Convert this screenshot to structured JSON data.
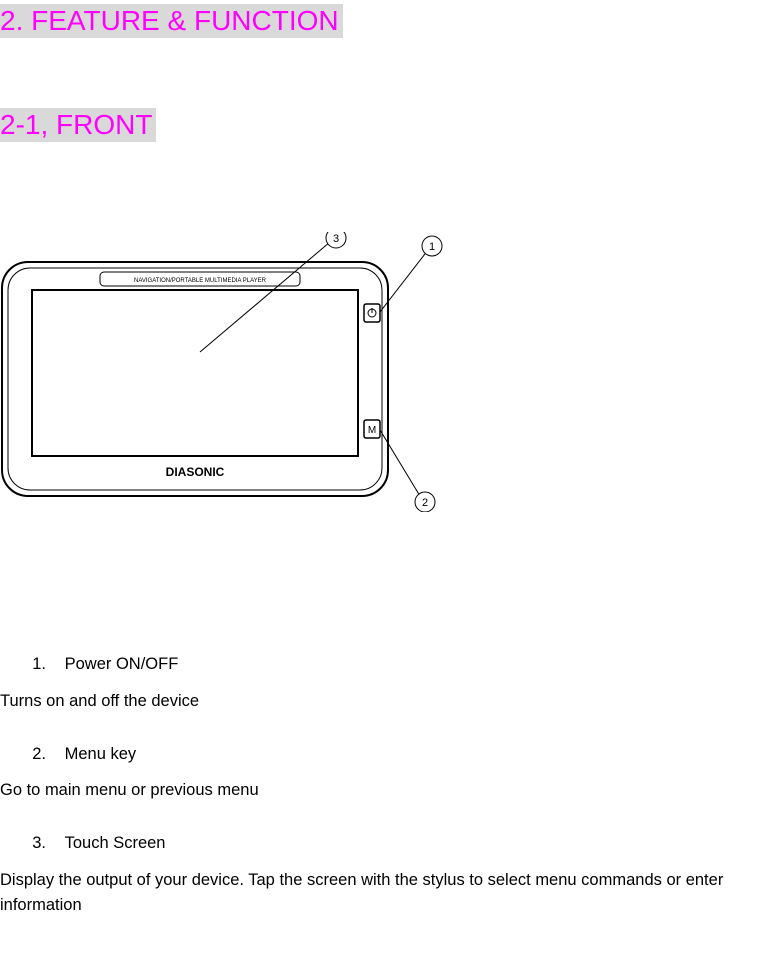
{
  "section": {
    "title": "2. FEATURE & FUNCTION",
    "subtitle": "2-1, FRONT"
  },
  "device": {
    "header_text": "NAVIGATION/PORTABLE MULTIMEDIA PLAYER",
    "brand": "DIASONIC",
    "power_icon_label": "power",
    "menu_button_label": "M"
  },
  "callouts": {
    "one": "1",
    "two": "2",
    "three": "3"
  },
  "items": [
    {
      "num": "1.",
      "label": "Power ON/OFF",
      "desc": "Turns on and off the device"
    },
    {
      "num": "2.",
      "label": "Menu key",
      "desc": "Go to main menu or previous menu"
    },
    {
      "num": "3.",
      "label": "Touch Screen",
      "desc": "Display the output of your device. Tap the screen with the stylus to select menu commands or enter information"
    }
  ]
}
